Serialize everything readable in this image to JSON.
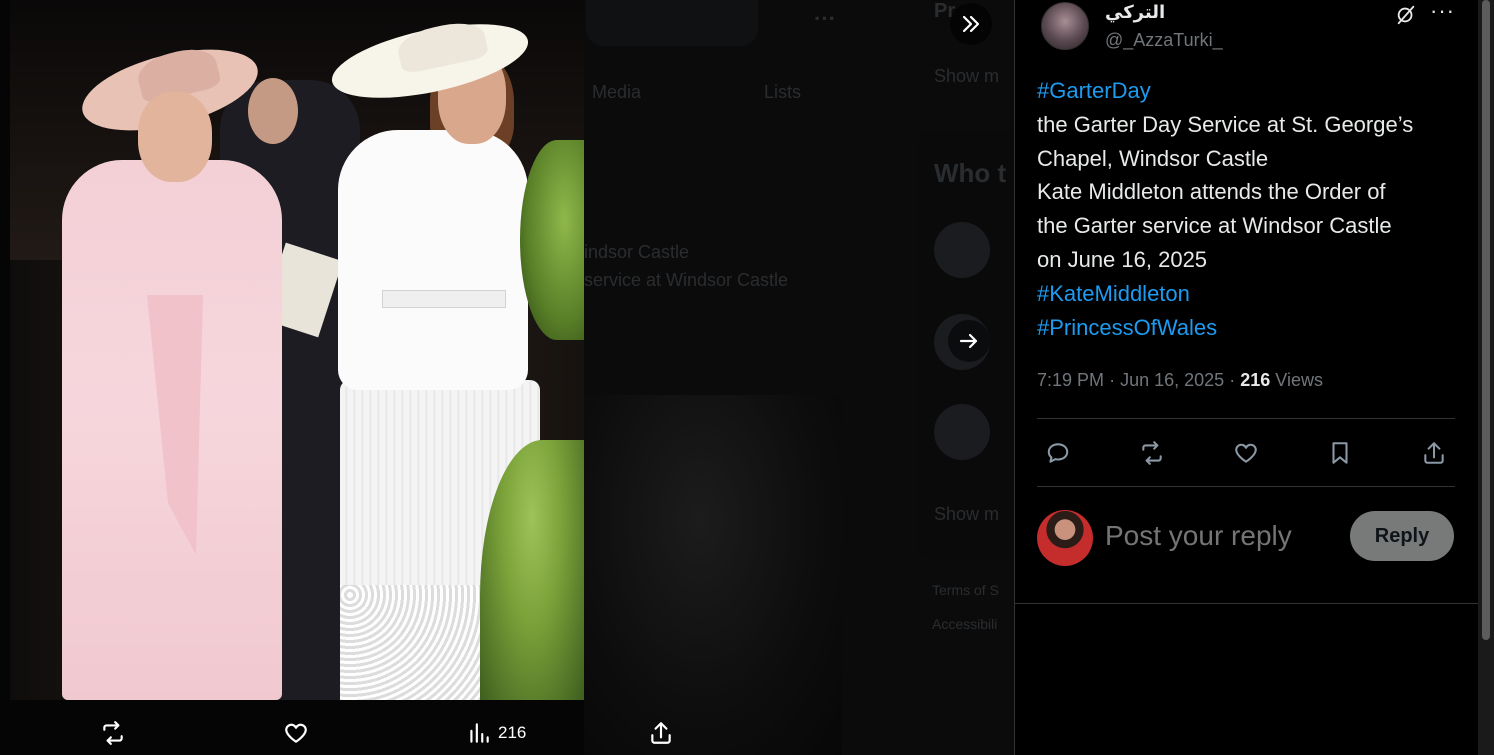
{
  "media_viewer": {
    "image_alt": "Two women in hats at the Garter Day Service",
    "actions": {
      "repost_icon": "repost-icon",
      "like_icon": "heart-icon",
      "views_icon": "analytics-icon",
      "views_count": "216",
      "share_icon": "share-icon"
    },
    "nav": {
      "collapse_icon": "double-chevron-right-icon",
      "next_icon": "arrow-right-icon"
    }
  },
  "background_ghost": {
    "tabs": [
      "Media",
      "Lists"
    ],
    "text_line_1": "indsor Castle",
    "text_line_2": "service at Windsor Castle",
    "who_to_follow": "Who t",
    "show_more_1": "Show m",
    "show_more_2": "Show m",
    "pr": "Pr",
    "terms": "Terms of S",
    "accessibility": "Accessibili"
  },
  "tweet": {
    "author_name": "التركي",
    "author_handle": "@_AzzaTurki_",
    "text_lines": [
      {
        "text": "#GarterDay",
        "hashtag": true
      },
      {
        "text": "the Garter Day Service at St. George’s",
        "hashtag": false
      },
      {
        "text": "Chapel, Windsor Castle",
        "hashtag": false
      },
      {
        "text": "Kate Middleton attends the Order of",
        "hashtag": false
      },
      {
        "text": "the Garter service at Windsor Castle",
        "hashtag": false
      },
      {
        "text": "on June 16, 2025",
        "hashtag": false
      },
      {
        "text": "#KateMiddleton",
        "hashtag": true
      },
      {
        "text": "#PrincessOfWales",
        "hashtag": true
      }
    ],
    "time": "7:19 PM",
    "date": "Jun 16, 2025",
    "views_count": "216",
    "views_label": "Views",
    "separator": "·"
  },
  "actions": {
    "reply_icon": "reply-icon",
    "repost_icon": "repost-icon",
    "like_icon": "heart-icon",
    "bookmark_icon": "bookmark-icon",
    "share_icon": "share-icon"
  },
  "reply": {
    "placeholder": "Post your reply",
    "button_label": "Reply"
  },
  "colors": {
    "background": "#000000",
    "text": "#e7e9ea",
    "muted": "#71767b",
    "accent": "#1d9bf0",
    "reply_button": "#787a7a"
  }
}
